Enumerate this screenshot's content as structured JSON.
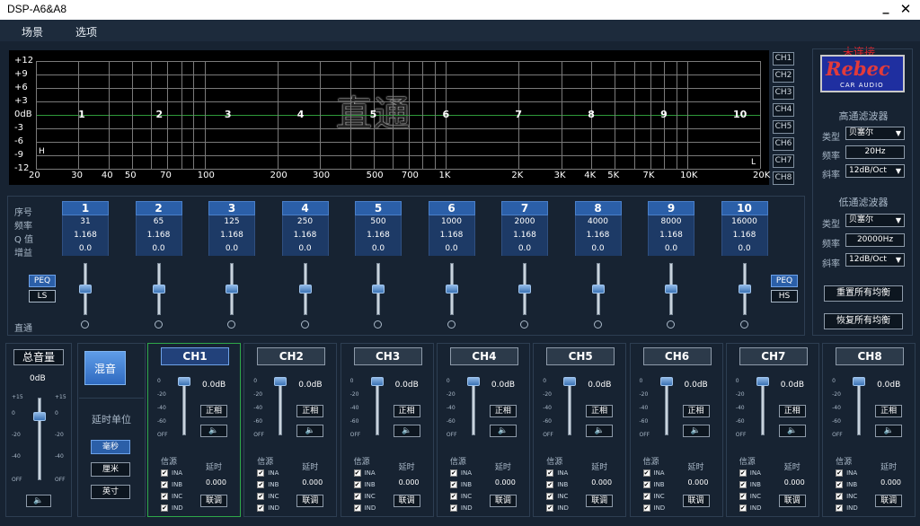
{
  "window": {
    "title": "DSP-A6&A8",
    "minimize": "_",
    "close": "✕"
  },
  "menu": [
    "场景",
    "选项"
  ],
  "status": {
    "connection": "未连接"
  },
  "graph": {
    "y_labels": [
      "+12",
      "+9",
      "+6",
      "+3",
      "0dB",
      "-3",
      "-6",
      "-9",
      "-12"
    ],
    "x_labels": [
      "20",
      "30",
      "40",
      "50",
      "70",
      "100",
      "200",
      "300",
      "500",
      "700",
      "1K",
      "2K",
      "3K",
      "4K",
      "5K",
      "7K",
      "10K",
      "20K"
    ],
    "mode_text": "直通",
    "band_markers": [
      "1",
      "2",
      "3",
      "4",
      "5",
      "6",
      "7",
      "8",
      "9",
      "10"
    ],
    "low_marker": "H",
    "high_marker": "L"
  },
  "channel_selector": [
    "CH1",
    "CH2",
    "CH3",
    "CH4",
    "CH5",
    "CH6",
    "CH7",
    "CH8"
  ],
  "eq": {
    "row_labels": {
      "index": "序号",
      "freq": "频率",
      "q": "Q 值",
      "gain": "增益",
      "bypass": "直通"
    },
    "bands": [
      {
        "n": "1",
        "freq": "31",
        "q": "1.168",
        "gain": "0.0",
        "level": 0.5
      },
      {
        "n": "2",
        "freq": "65",
        "q": "1.168",
        "gain": "0.0",
        "level": 0.5
      },
      {
        "n": "3",
        "freq": "125",
        "q": "1.168",
        "gain": "0.0",
        "level": 0.5
      },
      {
        "n": "4",
        "freq": "250",
        "q": "1.168",
        "gain": "0.0",
        "level": 0.5
      },
      {
        "n": "5",
        "freq": "500",
        "q": "1.168",
        "gain": "0.0",
        "level": 0.5
      },
      {
        "n": "6",
        "freq": "1000",
        "q": "1.168",
        "gain": "0.0",
        "level": 0.5
      },
      {
        "n": "7",
        "freq": "2000",
        "q": "1.168",
        "gain": "0.0",
        "level": 0.5
      },
      {
        "n": "8",
        "freq": "4000",
        "q": "1.168",
        "gain": "0.0",
        "level": 0.5
      },
      {
        "n": "9",
        "freq": "8000",
        "q": "1.168",
        "gain": "0.0",
        "level": 0.5
      },
      {
        "n": "10",
        "freq": "16000",
        "q": "1.168",
        "gain": "0.0",
        "level": 0.5
      }
    ],
    "left_buttons": {
      "peq": "PEQ",
      "ls": "LS"
    },
    "right_buttons": {
      "peq": "PEQ",
      "hs": "HS"
    }
  },
  "filters": {
    "logo_big": "Rebec",
    "logo_small": "CAR AUDIO",
    "highpass": {
      "title": "高通滤波器",
      "type_label": "类型",
      "type": "贝塞尔",
      "freq_label": "频率",
      "freq": "20Hz",
      "slope_label": "斜率",
      "slope": "12dB/Oct"
    },
    "lowpass": {
      "title": "低通滤波器",
      "type_label": "类型",
      "type": "贝塞尔",
      "freq_label": "频率",
      "freq": "20000Hz",
      "slope_label": "斜率",
      "slope": "12dB/Oct"
    },
    "reset_eq": "重置所有均衡",
    "restore_eq": "恢复所有均衡"
  },
  "master": {
    "title": "总音量",
    "value": "0dB",
    "scale": [
      "+15",
      "0",
      "-20",
      "-40",
      "OFF"
    ],
    "level": 0.23
  },
  "mix": {
    "label": "混音",
    "delay_unit_title": "延时单位",
    "units": [
      "毫秒",
      "厘米",
      "英寸"
    ]
  },
  "channel_strip": {
    "scale": [
      "0",
      "-20",
      "-40",
      "-60",
      "OFF"
    ],
    "phase": "正相",
    "source_label": "信源",
    "delay_label": "延时",
    "link": "联调",
    "inputs": [
      "INA",
      "INB",
      "INC",
      "IND"
    ]
  },
  "channels": [
    {
      "name": "CH1",
      "gain": "0.0dB",
      "delay": "0.000",
      "level": 0.0
    },
    {
      "name": "CH2",
      "gain": "0.0dB",
      "delay": "0.000",
      "level": 0.0
    },
    {
      "name": "CH3",
      "gain": "0.0dB",
      "delay": "0.000",
      "level": 0.0
    },
    {
      "name": "CH4",
      "gain": "0.0dB",
      "delay": "0.000",
      "level": 0.0
    },
    {
      "name": "CH5",
      "gain": "0.0dB",
      "delay": "0.000",
      "level": 0.0
    },
    {
      "name": "CH6",
      "gain": "0.0dB",
      "delay": "0.000",
      "level": 0.0
    },
    {
      "name": "CH7",
      "gain": "0.0dB",
      "delay": "0.000",
      "level": 0.0
    },
    {
      "name": "CH8",
      "gain": "0.0dB",
      "delay": "0.000",
      "level": 0.0
    }
  ],
  "colors": {
    "accent": "#2b5fa8",
    "status_disconnected": "#e0242c",
    "active_channel_border": "#2fa84a"
  }
}
